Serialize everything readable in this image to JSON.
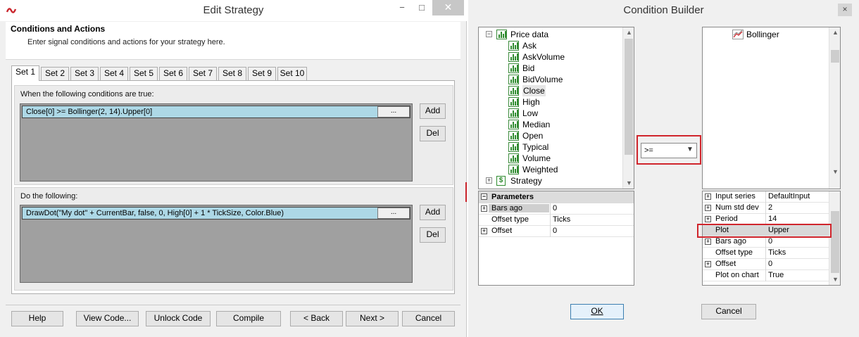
{
  "edit_strategy": {
    "title": "Edit Strategy",
    "window_controls": {
      "minimize": "−",
      "maximize": "□",
      "close": "✕"
    },
    "header": {
      "title": "Conditions and Actions",
      "subtitle": "Enter signal conditions and actions for your strategy here."
    },
    "tabs": [
      "Set 1",
      "Set 2",
      "Set 3",
      "Set 4",
      "Set 5",
      "Set 6",
      "Set 7",
      "Set 8",
      "Set 9",
      "Set 10"
    ],
    "active_tab": "Set 1",
    "conditions": {
      "label": "When the following conditions are true:",
      "items": [
        "Close[0] >= Bollinger(2, 14).Upper[0]"
      ],
      "ellipsis": "...",
      "add": "Add",
      "del": "Del"
    },
    "actions": {
      "label": "Do the following:",
      "items": [
        "DrawDot(\"My dot\" + CurrentBar, false, 0, High[0] + 1 * TickSize, Color.Blue)"
      ],
      "ellipsis": "...",
      "add": "Add",
      "del": "Del"
    },
    "buttons": {
      "help": "Help",
      "view_code": "View Code...",
      "unlock_code": "Unlock Code",
      "compile": "Compile",
      "back": "< Back",
      "next": "Next >",
      "cancel": "Cancel"
    }
  },
  "condition_builder": {
    "title": "Condition Builder",
    "close": "×",
    "left_tree": {
      "group": "Price data",
      "items": [
        "Ask",
        "AskVolume",
        "Bid",
        "BidVolume",
        "Close",
        "High",
        "Low",
        "Median",
        "Open",
        "Typical",
        "Volume",
        "Weighted"
      ],
      "selected": "Close",
      "next_group": "Strategy"
    },
    "left_params": {
      "header": "Parameters",
      "rows": [
        {
          "key": "Bars ago",
          "value": "0"
        },
        {
          "key": "Offset type",
          "value": "Ticks"
        },
        {
          "key": "Offset",
          "value": "0"
        }
      ]
    },
    "operator": {
      "value": ">="
    },
    "right_tree": {
      "item": "Bollinger"
    },
    "right_params": {
      "rows": [
        {
          "key": "Input series",
          "value": "DefaultInput"
        },
        {
          "key": "Num std dev",
          "value": "2"
        },
        {
          "key": "Period",
          "value": "14"
        },
        {
          "key": "Plot",
          "value": "Upper"
        },
        {
          "key": "Bars ago",
          "value": "0"
        },
        {
          "key": "Offset type",
          "value": "Ticks"
        },
        {
          "key": "Offset",
          "value": "0"
        },
        {
          "key": "Plot on chart",
          "value": "True"
        }
      ]
    },
    "buttons": {
      "ok": "OK",
      "cancel": "Cancel"
    }
  },
  "colors": {
    "row_highlight": "#add8e6",
    "list_background": "#a0a0a0",
    "red_box": "#d0252c",
    "chart_icon": "#2e8b2e"
  }
}
